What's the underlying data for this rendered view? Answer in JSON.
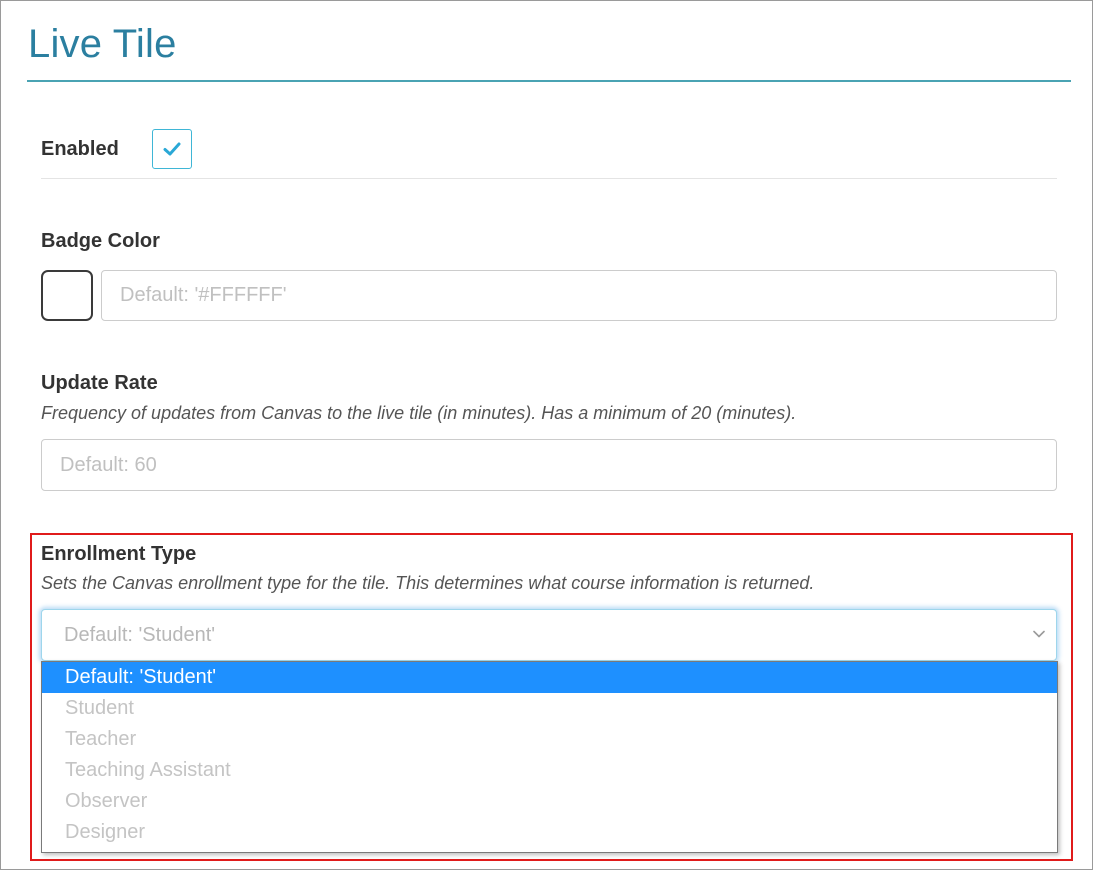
{
  "section": {
    "title": "Live Tile"
  },
  "enabled": {
    "label": "Enabled",
    "checked": true,
    "check_icon": "check-icon"
  },
  "badge_color": {
    "label": "Badge Color",
    "swatch_color": "#FFFFFF",
    "input_value": "",
    "placeholder": "Default: '#FFFFFF'"
  },
  "update_rate": {
    "label": "Update Rate",
    "help": "Frequency of updates from Canvas to the live tile (in minutes). Has a minimum of 20 (minutes).",
    "input_value": "",
    "placeholder": "Default: 60"
  },
  "enrollment_type": {
    "label": "Enrollment Type",
    "help": "Sets the Canvas enrollment type for the tile. This determines what course information is returned.",
    "selected": "Default: 'Student'",
    "chevron_icon": "chevron-down-icon",
    "options": [
      "Default: 'Student'",
      "Student",
      "Teacher",
      "Teaching Assistant",
      "Observer",
      "Designer"
    ],
    "highlighted_index": 0
  },
  "colors": {
    "accent": "#2B7FA0",
    "rule": "#4AA3B3",
    "focus": "#3FB6D6",
    "highlight_border": "#E01B1B",
    "option_selected": "#1E90FF"
  }
}
